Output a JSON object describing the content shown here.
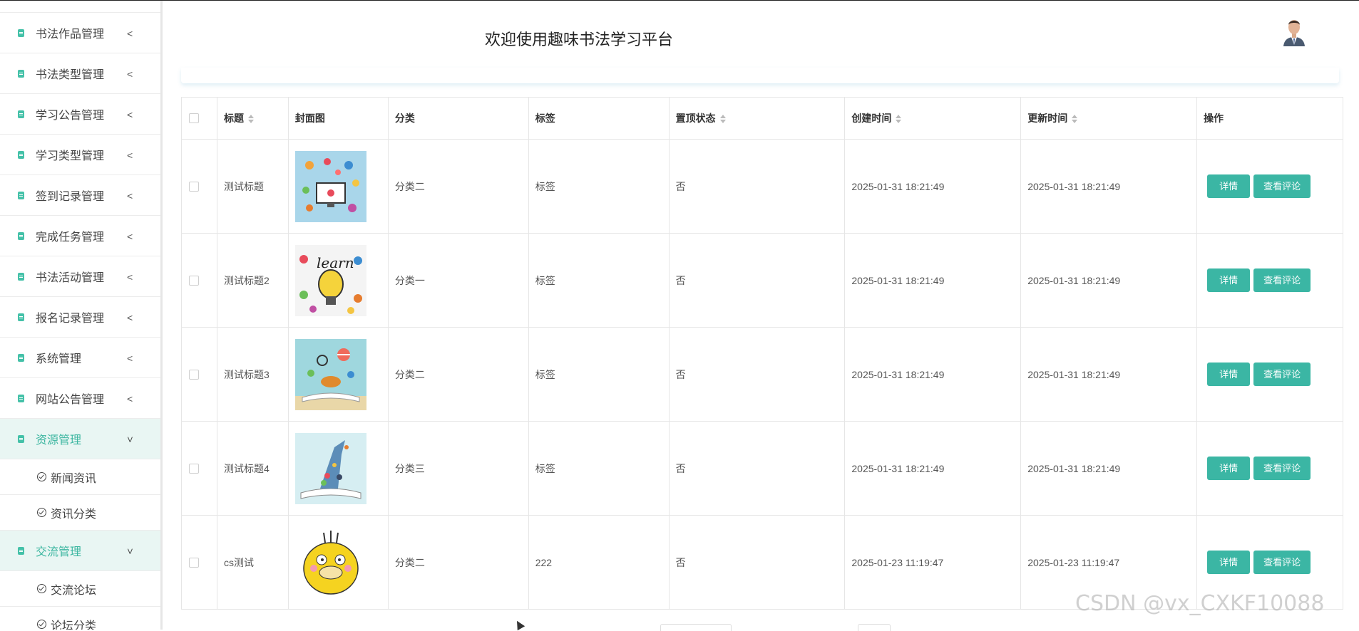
{
  "header": {
    "title": "欢迎使用趣味书法学习平台"
  },
  "sidebar": {
    "items": [
      {
        "label": "书法作品管理"
      },
      {
        "label": "书法类型管理"
      },
      {
        "label": "学习公告管理"
      },
      {
        "label": "学习类型管理"
      },
      {
        "label": "签到记录管理"
      },
      {
        "label": "完成任务管理"
      },
      {
        "label": "书法活动管理"
      },
      {
        "label": "报名记录管理"
      },
      {
        "label": "系统管理"
      },
      {
        "label": "网站公告管理"
      }
    ],
    "resource": {
      "label": "资源管理",
      "children": [
        {
          "label": "新闻资讯"
        },
        {
          "label": "资讯分类"
        }
      ]
    },
    "exchange": {
      "label": "交流管理",
      "children": [
        {
          "label": "交流论坛"
        },
        {
          "label": "论坛分类"
        }
      ]
    }
  },
  "table": {
    "headers": {
      "title": "标题",
      "cover": "封面图",
      "category": "分类",
      "tag": "标签",
      "pinned": "置顶状态",
      "created": "创建时间",
      "updated": "更新时间",
      "actions": "操作"
    },
    "rows": [
      {
        "title": "测试标题",
        "category": "分类二",
        "tag": "标签",
        "pinned": "否",
        "created": "2025-01-31 18:21:49",
        "updated": "2025-01-31 18:21:49"
      },
      {
        "title": "测试标题2",
        "category": "分类一",
        "tag": "标签",
        "pinned": "否",
        "created": "2025-01-31 18:21:49",
        "updated": "2025-01-31 18:21:49"
      },
      {
        "title": "测试标题3",
        "category": "分类二",
        "tag": "标签",
        "pinned": "否",
        "created": "2025-01-31 18:21:49",
        "updated": "2025-01-31 18:21:49"
      },
      {
        "title": "测试标题4",
        "category": "分类三",
        "tag": "标签",
        "pinned": "否",
        "created": "2025-01-31 18:21:49",
        "updated": "2025-01-31 18:21:49"
      },
      {
        "title": "cs测试",
        "category": "分类二",
        "tag": "222",
        "pinned": "否",
        "created": "2025-01-23 11:19:47",
        "updated": "2025-01-23 11:19:47"
      }
    ],
    "buttons": {
      "detail": "详情",
      "comments": "查看评论"
    }
  },
  "watermark": "CSDN @vx_CXKF10088",
  "colors": {
    "accent": "#3bb6a4",
    "active_bg": "#e9f6f3"
  }
}
